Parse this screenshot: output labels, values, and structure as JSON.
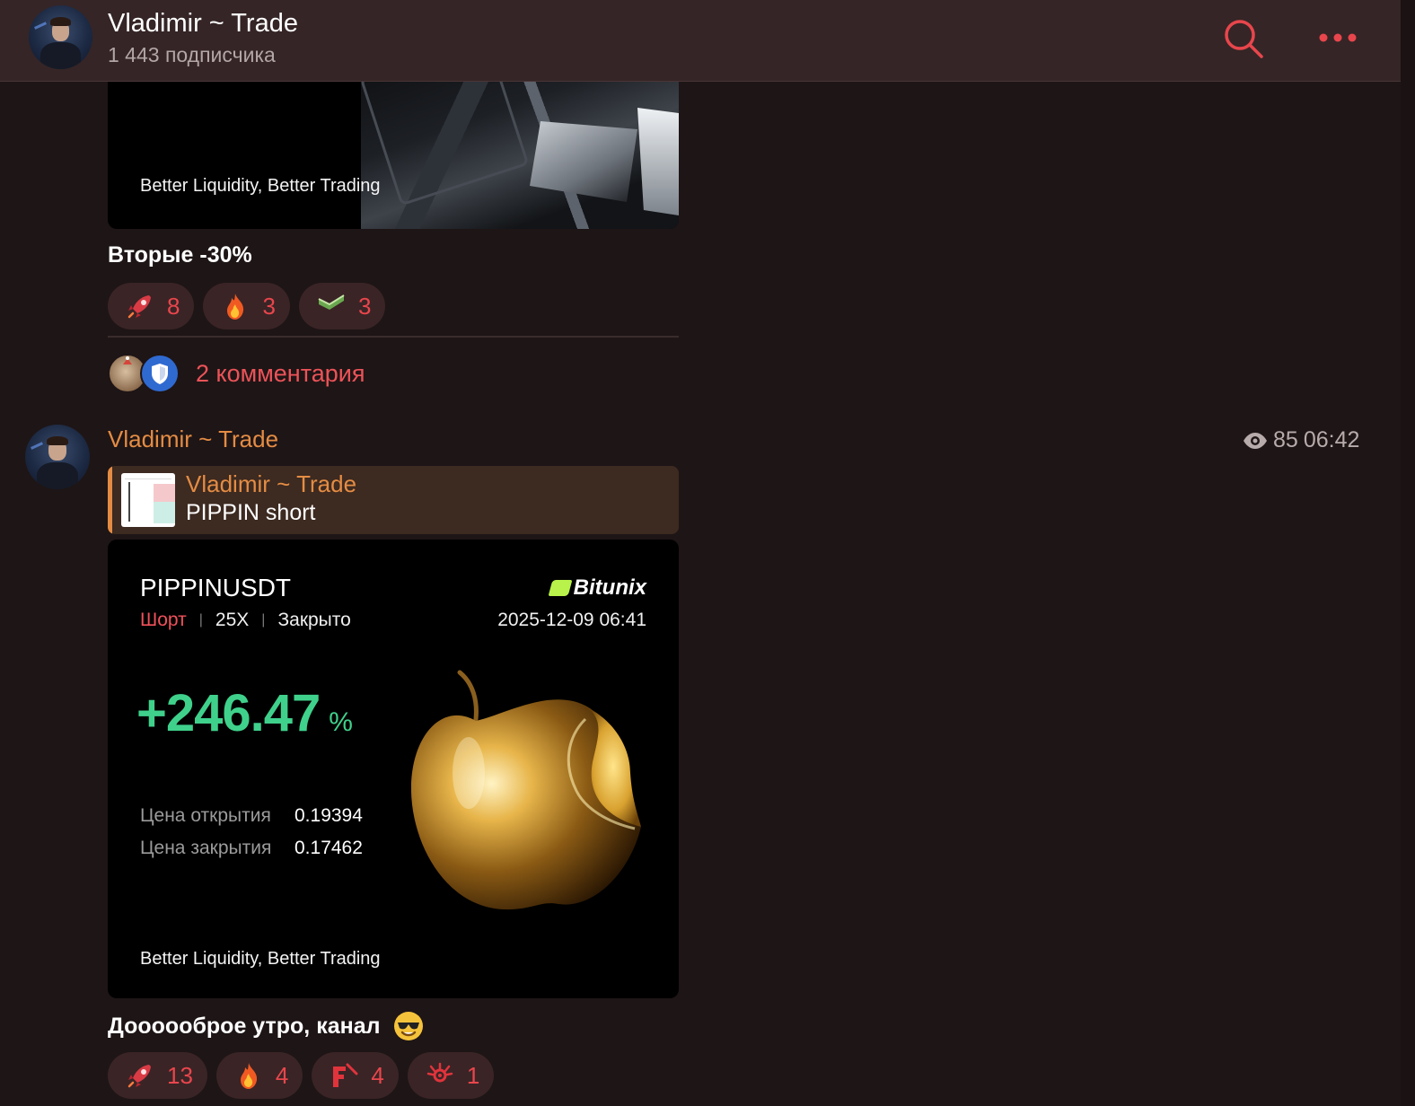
{
  "header": {
    "title": "Vladimir ~ Trade",
    "subscribers": "1 443 подписчика"
  },
  "post1": {
    "image_tagline": "Better Liquidity, Better Trading",
    "text": "Вторые -30%",
    "reactions": [
      {
        "icon": "rocket-icon",
        "count": "8"
      },
      {
        "icon": "fire-icon",
        "count": "3"
      },
      {
        "icon": "money-icon",
        "count": "3"
      }
    ],
    "comments_label": "2 комментария"
  },
  "post2": {
    "author": "Vladimir ~ Trade",
    "views": "85",
    "time": "06:42",
    "reply": {
      "author": "Vladimir ~ Trade",
      "text": "PIPPIN short"
    },
    "card": {
      "symbol": "PIPPINUSDT",
      "brand": "Bitunix",
      "side": "Шорт",
      "leverage": "25X",
      "status": "Закрыто",
      "datetime": "2025-12-09 06:41",
      "pnl_value": "+246.47",
      "pnl_unit": "%",
      "open_price_label": "Цена открытия",
      "open_price": "0.19394",
      "close_price_label": "Цена закрытия",
      "close_price": "0.17462",
      "tagline": "Better Liquidity, Better Trading"
    },
    "text": "Доооооброе утро, канал",
    "text_emoji": "sunglasses-smiley-icon",
    "reactions": [
      {
        "icon": "rocket-icon",
        "count": "13"
      },
      {
        "icon": "fire-icon",
        "count": "4"
      },
      {
        "icon": "letter-f-icon",
        "count": "4"
      },
      {
        "icon": "eyes-icon",
        "count": "1"
      }
    ]
  },
  "colors": {
    "accent": "#e8464c",
    "author": "#e48c44",
    "profit": "#3fd18b",
    "short": "#f0515b",
    "brand_mark": "#b8f24a"
  }
}
